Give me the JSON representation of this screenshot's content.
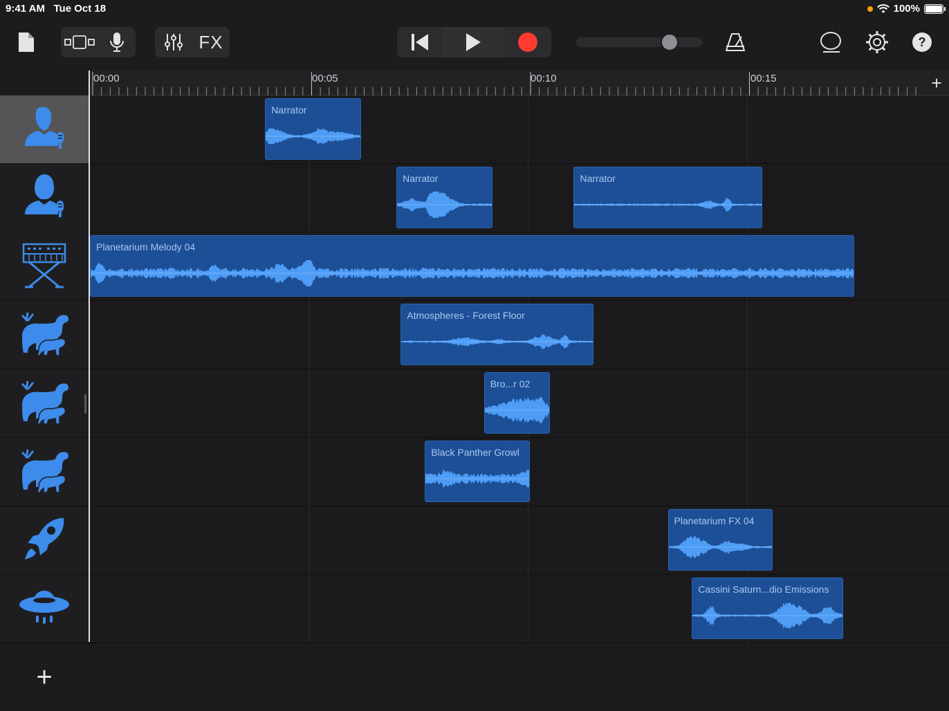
{
  "status": {
    "time": "9:41 AM",
    "date": "Tue Oct 18",
    "battery": "100%"
  },
  "toolbar": {
    "fx_label": "FX",
    "master_volume": 0.78,
    "accent_record": "#ff3b30"
  },
  "ruler": {
    "labels": [
      "00:00",
      "00:05",
      "00:10",
      "00:15"
    ],
    "add_label": "+"
  },
  "tracks": [
    {
      "icon": "male-voice-icon",
      "selected": true
    },
    {
      "icon": "female-voice-icon",
      "selected": false
    },
    {
      "icon": "keyboard-icon",
      "selected": false
    },
    {
      "icon": "animals-icon",
      "selected": false
    },
    {
      "icon": "animals-icon",
      "selected": false
    },
    {
      "icon": "animals-icon",
      "selected": false
    },
    {
      "icon": "rocket-icon",
      "selected": false
    },
    {
      "icon": "ufo-icon",
      "selected": false
    }
  ],
  "add_track_label": "+",
  "regions": [
    {
      "track": 0,
      "name": "Narrator",
      "start": 4.0,
      "end": 6.2
    },
    {
      "track": 1,
      "name": "Narrator",
      "start": 7.0,
      "end": 9.2
    },
    {
      "track": 1,
      "name": "Narrator",
      "start": 11.05,
      "end": 15.35
    },
    {
      "track": 2,
      "name": "Planetarium Melody 04",
      "start": 0.0,
      "end": 17.45
    },
    {
      "track": 3,
      "name": "Atmospheres - Forest Floor",
      "start": 7.1,
      "end": 11.5
    },
    {
      "track": 4,
      "name": "Bro...r 02",
      "start": 9.0,
      "end": 10.5
    },
    {
      "track": 5,
      "name": "Black Panther Growl",
      "start": 7.65,
      "end": 10.05
    },
    {
      "track": 6,
      "name": "Planetarium FX 04",
      "start": 13.2,
      "end": 15.6
    },
    {
      "track": 7,
      "name": "Cassini Saturn...dio Emissions",
      "start": 13.75,
      "end": 17.2
    }
  ]
}
